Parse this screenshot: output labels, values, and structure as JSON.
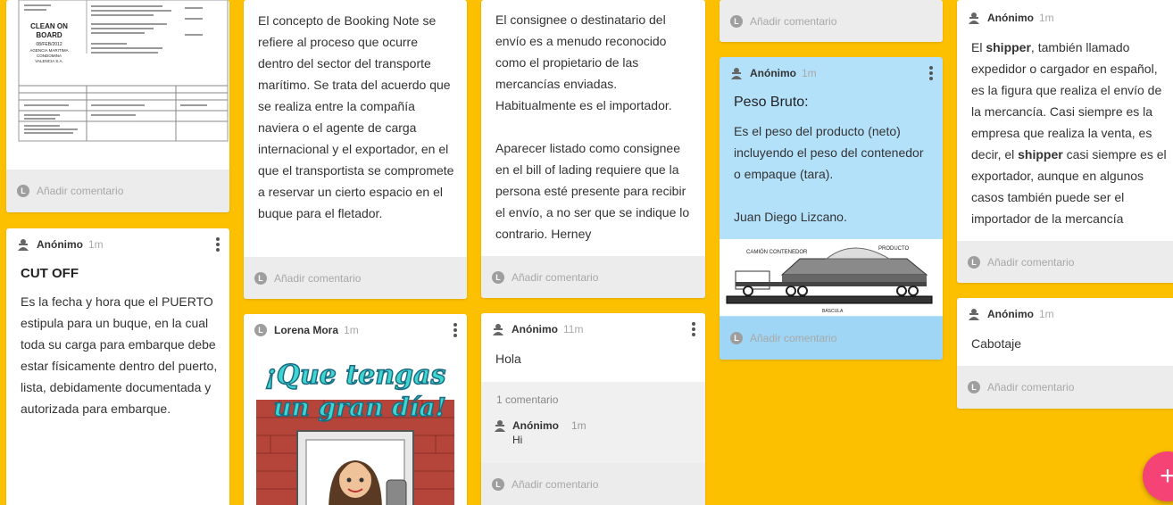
{
  "footer_label": "Añadir comentario",
  "avatar_letter": "L",
  "cards": {
    "bl": {
      "doc_clean_on_board": "CLEAN ON\nBOARD",
      "doc_date": "08/FEB/2012",
      "doc_agency": "AGENCIA MARITIMA\nCONDOMINA\nVALENCIA S.A."
    },
    "cutoff": {
      "author": "Anónimo",
      "time": "1m",
      "title": "CUT OFF",
      "body": "Es la fecha y hora que el PUERTO estipula para un buque, en la cual toda su carga para embarque debe estar físicamente dentro del puerto, lista, debidamente documentada y autorizada para embarque."
    },
    "booking": {
      "body": "El concepto de Booking Note se refiere al proceso que ocurre dentro del sector del transporte marítimo. Se trata del acuerdo que se realiza entre la compañía naviera o el agente de carga internacional y el exportador, en el que el transportista se compromete a reservar un cierto espacio en el buque para el fletador."
    },
    "lorena": {
      "author": "Lorena Mora",
      "time": "1m",
      "image_text_1": "¡Que tengas",
      "image_text_2": "un gran día!"
    },
    "consignee": {
      "body": "El consignee o destinatario del envío es a menudo reconocido como el propietario de las mercancías enviadas. Habitualmente es el importador.\n\nAparecer listado como consignee en el bill of lading requiere que la persona esté presente para recibir el envío, a no ser que se indique lo contrario. Herney"
    },
    "hola": {
      "author": "Anónimo",
      "time": "11m",
      "body": "Hola",
      "comment_count": "1 comentario",
      "comment_author": "Anónimo",
      "comment_time": "1m",
      "comment_text": "Hi"
    },
    "peso": {
      "author": "Anónimo",
      "time": "1m",
      "title": "Peso Bruto:",
      "body": "Es el peso del producto (neto) incluyendo el peso del contenedor o empaque (tara).\n\nJuan Diego Lizcano.",
      "img_camion": "CAMIÓN CONTENEDOR",
      "img_producto": "PRODUCTO",
      "img_bascula": "BÁSCULA"
    },
    "shipper": {
      "author": "Anónimo",
      "time": "1m",
      "p1": "El ",
      "b1": "shipper",
      "p2": ", también llamado expedidor o cargador en español, es la figura que realiza el envío de la mercancía. Casi siempre es la empresa que realiza la venta, es decir, el ",
      "b2": "shipper",
      "p3": " casi siempre es el exportador, aunque en algunos casos también puede ser el importador de la mercancía"
    },
    "cabotaje": {
      "author": "Anónimo",
      "time": "1m",
      "body": "Cabotaje"
    }
  },
  "fab_label": "+",
  "colors": {
    "board_bg": "#fcc000",
    "blue_card": "#b3e1fa",
    "fab": "#f44374"
  }
}
